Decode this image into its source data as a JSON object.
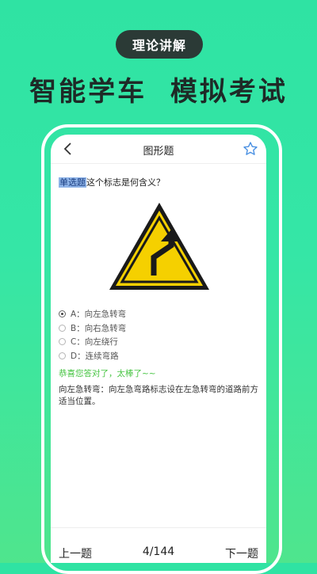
{
  "banner": {
    "pill_label": "理论讲解",
    "headline": "智能学车  模拟考试"
  },
  "topbar": {
    "back_icon": "chevron-left-icon",
    "title": "图形题",
    "favorite_icon": "star-outline-icon"
  },
  "question": {
    "type_tag": "单选题",
    "text": "这个标志是何含义？",
    "sign_icon": "sharp-left-turn-warning-sign"
  },
  "options": [
    {
      "label": "A：向左急转弯",
      "selected": true
    },
    {
      "label": "B：向右急转弯",
      "selected": false
    },
    {
      "label": "C：向左绕行",
      "selected": false
    },
    {
      "label": "D：连续弯路",
      "selected": false
    }
  ],
  "feedback": "恭喜您答对了，太棒了~~",
  "explanation": "向左急转弯：向左急弯路标志设在左急转弯的道路前方适当位置。",
  "nav": {
    "prev_label": "上一题",
    "page_indicator": "4/144",
    "next_label": "下一题"
  },
  "colors": {
    "background_top": "#2fe3a3",
    "background_bottom": "#4fe58d",
    "pill_bg": "#2b3a36",
    "correct_feedback": "#45c441",
    "tag_highlight": "#8fb4e8",
    "sign_yellow": "#f5d000",
    "star_blue": "#4a90e2"
  }
}
